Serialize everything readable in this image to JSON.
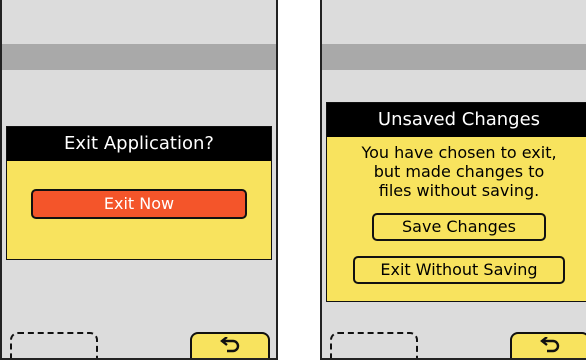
{
  "left_screen": {
    "dialog": {
      "title": "Exit Application?",
      "exit_button": "Exit Now"
    },
    "softkeys": {
      "back_icon": "back-arrow-icon"
    }
  },
  "right_screen": {
    "dialog": {
      "title": "Unsaved Changes",
      "message_lines": [
        "You have chosen to exit,",
        "but made changes to",
        "files without saving."
      ],
      "save_button": "Save Changes",
      "exit_button": "Exit Without Saving"
    },
    "softkeys": {
      "back_icon": "back-arrow-icon"
    }
  },
  "colors": {
    "screen_bg": "#dcdcdc",
    "title_bar": "#a9a9a9",
    "dialog_bg": "#f8e35e",
    "dialog_header_bg": "#000000",
    "danger_button": "#f4552a"
  }
}
